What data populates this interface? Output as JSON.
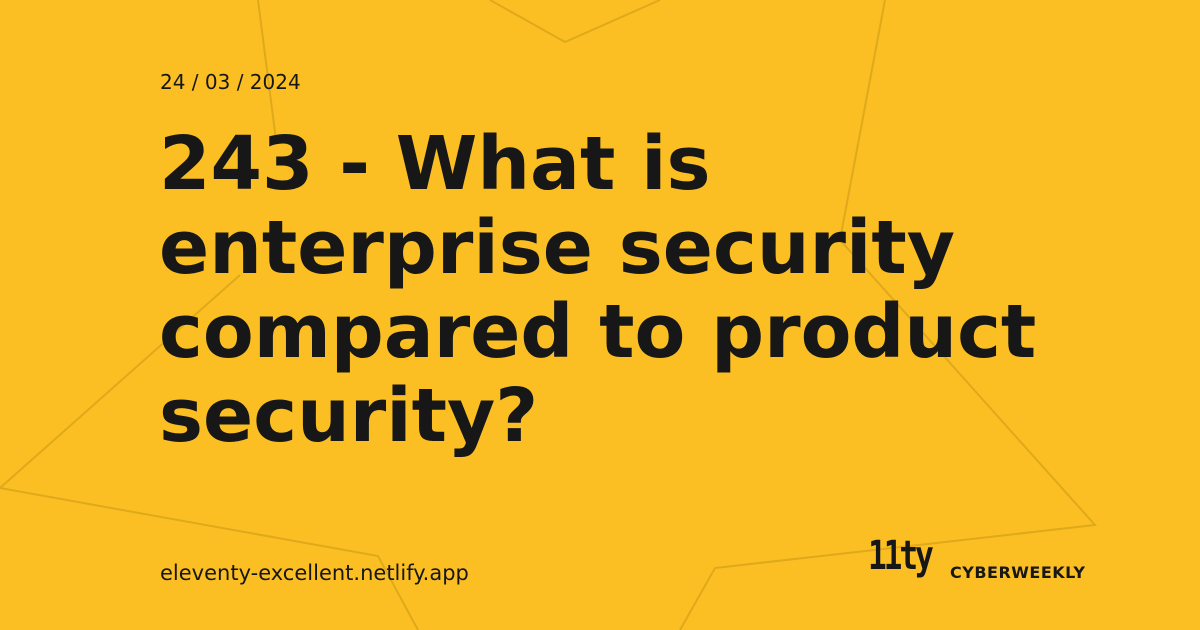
{
  "card": {
    "date": "24 / 03 / 2024",
    "title": "243 - What is enterprise security compared to product security?",
    "url": "eleventy-excellent.netlify.app",
    "logo_text": "11ty",
    "brand_name": "CYBERWEEKLY"
  },
  "colors": {
    "background": "#fbbf24",
    "text": "#171717",
    "decor_lines": "#e0a91a"
  }
}
